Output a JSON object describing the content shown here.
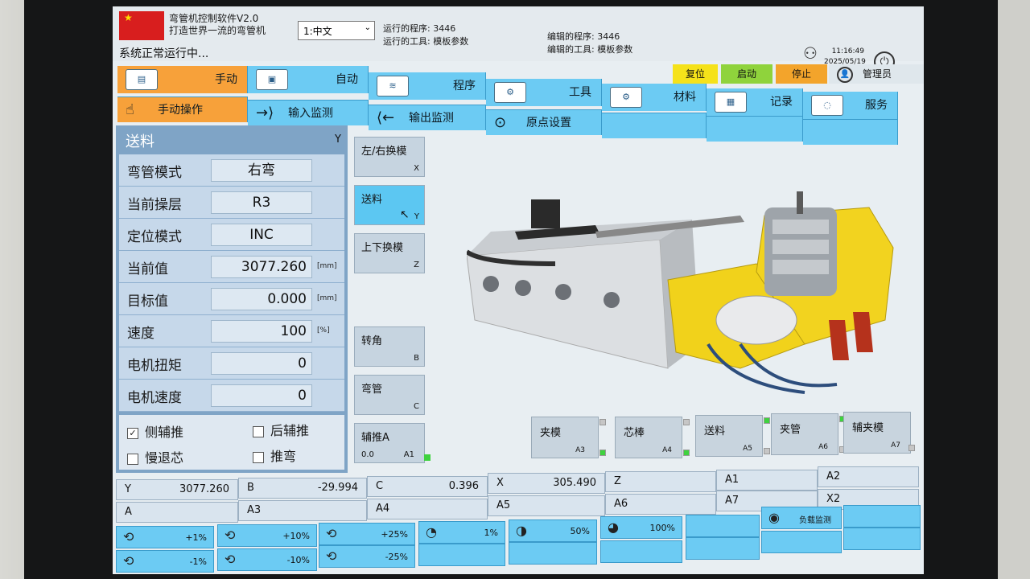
{
  "header": {
    "flag_stars": "★",
    "app_title": "弯管机控制软件V2.0",
    "app_slogan": "打造世界一流的弯管机",
    "language": "1:中文",
    "run_program_label": "运行的程序:",
    "run_program_value": "3446",
    "run_tool_label": "运行的工具:",
    "run_tool_value": "模板参数",
    "edit_program_label": "编辑的程序:",
    "edit_program_value": "3446",
    "edit_tool_label": "编辑的工具:",
    "edit_tool_value": "模板参数",
    "status": "系统正常运行中...",
    "time": "11:16:49",
    "date": "2025/05/19"
  },
  "controls": {
    "reset": "复位",
    "start": "启动",
    "stop": "停止",
    "admin": "管理员"
  },
  "tabs": [
    "手动",
    "自动",
    "程序",
    "工具",
    "材料",
    "记录",
    "服务"
  ],
  "subtabs": [
    "手动操作",
    "输入监测",
    "输出监测",
    "原点设置"
  ],
  "panel": {
    "title": "送料",
    "axis": "Y",
    "rows": [
      {
        "label": "弯管模式",
        "value": "右弯",
        "unit": ""
      },
      {
        "label": "当前操层",
        "value": "R3",
        "unit": ""
      },
      {
        "label": "定位模式",
        "value": "INC",
        "unit": ""
      },
      {
        "label": "当前值",
        "value": "3077.260",
        "unit": "[mm]"
      },
      {
        "label": "目标值",
        "value": "0.000",
        "unit": "[mm]"
      },
      {
        "label": "速度",
        "value": "100",
        "unit": "[%]"
      },
      {
        "label": "电机扭矩",
        "value": "0",
        "unit": ""
      },
      {
        "label": "电机速度",
        "value": "0",
        "unit": ""
      }
    ],
    "checks": [
      {
        "label": "侧辅推",
        "checked": true
      },
      {
        "label": "后辅推",
        "checked": false
      },
      {
        "label": "慢退芯",
        "checked": false
      },
      {
        "label": "推弯",
        "checked": false
      }
    ]
  },
  "axis_buttons": [
    {
      "label": "左/右换模",
      "key": "X"
    },
    {
      "label": "送料",
      "key": "Y"
    },
    {
      "label": "上下换模",
      "key": "Z"
    },
    {
      "label": "转角",
      "key": "B"
    },
    {
      "label": "弯管",
      "key": "C"
    },
    {
      "label": "辅推A",
      "key": "A1",
      "value": "0.0"
    }
  ],
  "small_buttons": [
    {
      "label": "夹模",
      "key": "A3"
    },
    {
      "label": "芯棒",
      "key": "A4"
    },
    {
      "label": "送料",
      "key": "A5"
    },
    {
      "label": "夹管",
      "key": "A6"
    },
    {
      "label": "辅夹模",
      "key": "A7"
    }
  ],
  "positions": {
    "y_label": "Y",
    "y_value": "3077.260",
    "b_label": "B",
    "b_value": "-29.994",
    "c_label": "C",
    "c_value": "0.396",
    "x_label": "X",
    "x_value": "305.490",
    "z_label": "Z",
    "a1_label": "A1",
    "a2_label": "A2",
    "a_label": "A",
    "a3_label": "A3",
    "a4_label": "A4",
    "a5_label": "A5",
    "a6_label": "A6",
    "a7_label": "A7",
    "x2_label": "X2"
  },
  "overrides": {
    "p1": "+1%",
    "p10": "+10%",
    "p25": "+25%",
    "m1": "-1%",
    "m10": "-10%",
    "m25": "-25%",
    "s1": "1%",
    "s50": "50%",
    "s100": "100%",
    "load_monitor": "负载监测"
  },
  "colors": {
    "tab_blue": "#6ccbf3",
    "active_orange": "#f7a13a",
    "reset_yellow": "#f5e21a",
    "start_green": "#8fd33c",
    "stop_orange": "#f3a42b",
    "panel_blue": "#7fa4c6",
    "led_green": "#3fd23f"
  }
}
